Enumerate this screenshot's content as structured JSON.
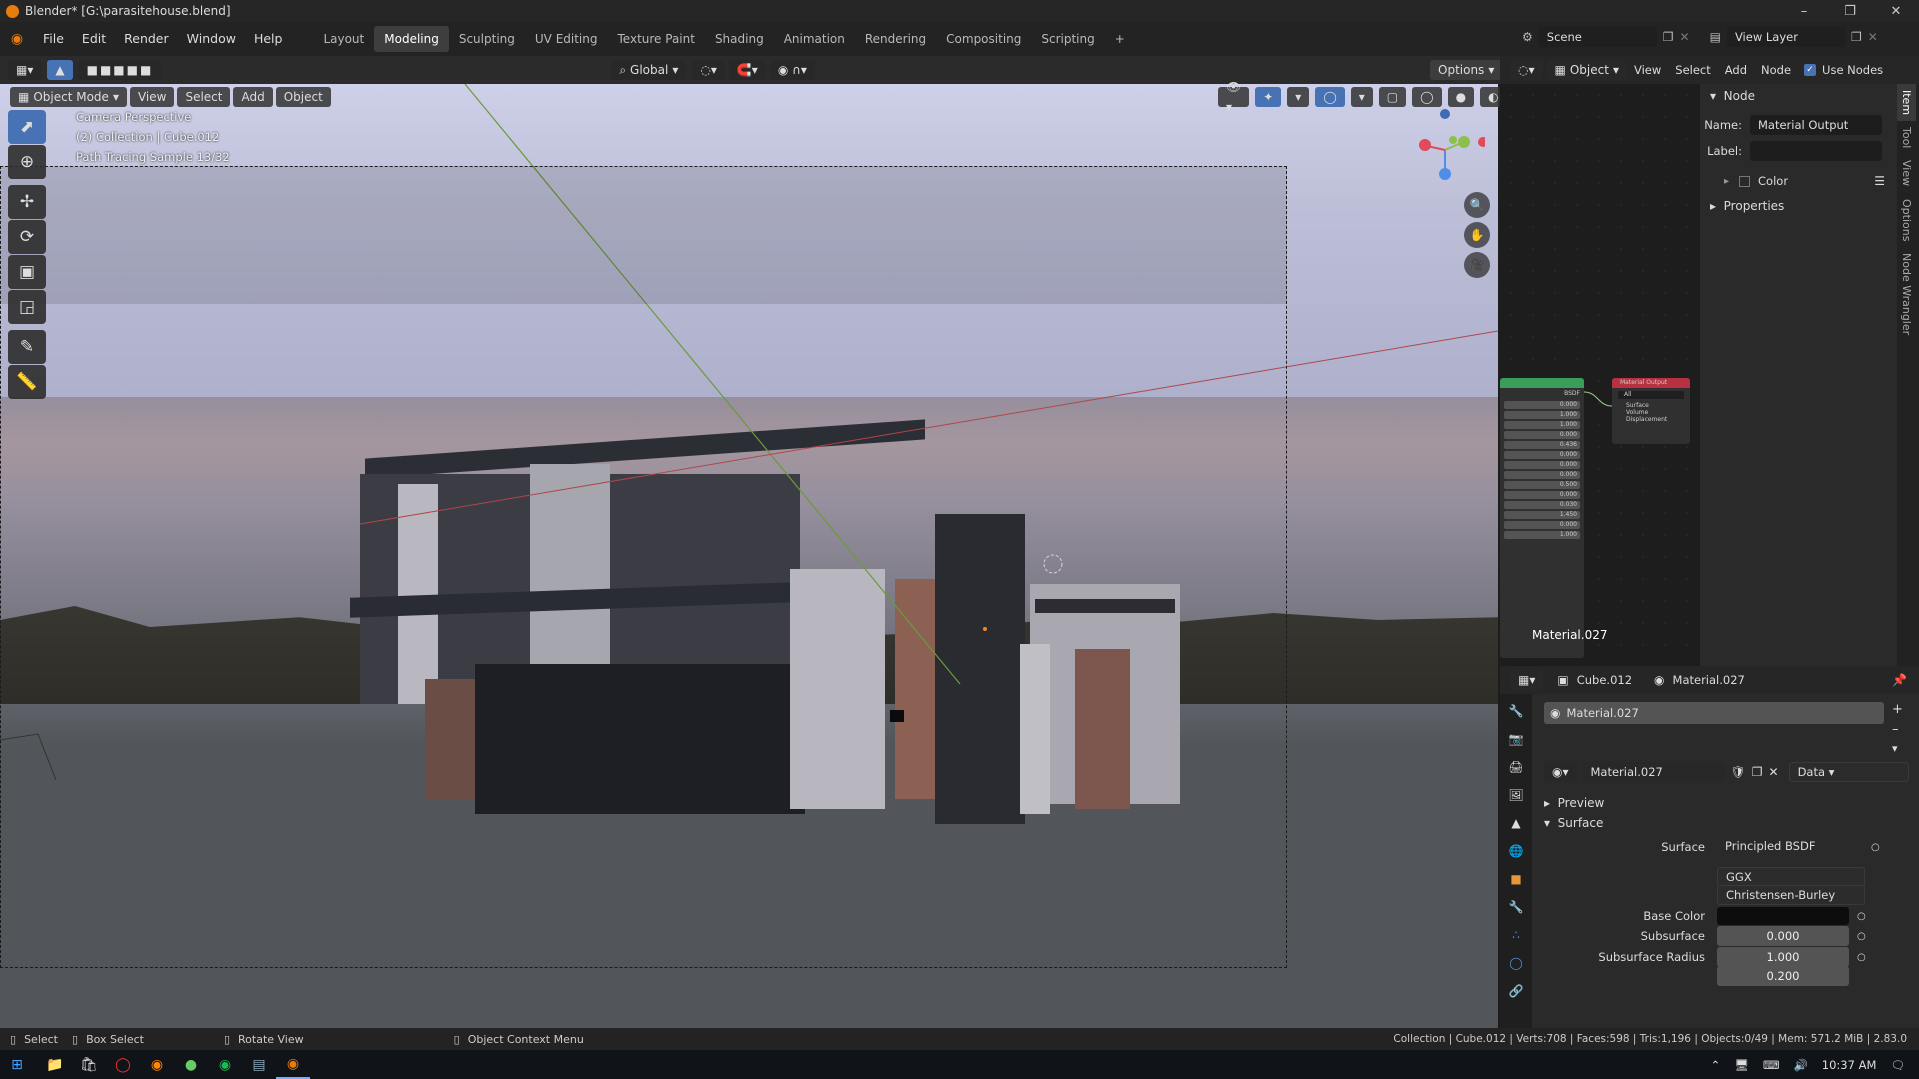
{
  "window": {
    "title": "Blender* [G:\\parasitehouse.blend]"
  },
  "menus": [
    "File",
    "Edit",
    "Render",
    "Window",
    "Help"
  ],
  "workspaces": [
    "Layout",
    "Modeling",
    "Sculpting",
    "UV Editing",
    "Texture Paint",
    "Shading",
    "Animation",
    "Rendering",
    "Compositing",
    "Scripting"
  ],
  "active_workspace": "Modeling",
  "scene": {
    "name": "Scene",
    "view_layer": "View Layer"
  },
  "toolrow": {
    "orientation": "Global",
    "options": "Options"
  },
  "viewport_header": {
    "mode": "Object Mode",
    "menus": [
      "View",
      "Select",
      "Add",
      "Object"
    ]
  },
  "viewport_overlay": {
    "line1": "Camera Perspective",
    "line2": "(2) Collection | Cube.012",
    "line3": "Path Tracing Sample 13/32"
  },
  "node_editor": {
    "header": {
      "type": "Object",
      "menus": [
        "View",
        "Select",
        "Add",
        "Node"
      ],
      "use_nodes": "Use Nodes"
    },
    "bsdf_node": {
      "socket": "BSDF",
      "values": [
        "0.000",
        "1.000",
        "1.000",
        "0.000",
        "0.436",
        "0.000",
        "0.000",
        "0.000",
        "0.500",
        "0.000",
        "0.030",
        "1.450",
        "0.000",
        "1.000"
      ]
    },
    "output_node": {
      "title": "Material Output",
      "target": "All",
      "sockets": [
        "Surface",
        "Volume",
        "Displacement"
      ]
    },
    "material_label": "Material.027"
  },
  "npanel": {
    "section": "Node",
    "name_label": "Name:",
    "name_value": "Material Output",
    "label_label": "Label:",
    "color_label": "Color",
    "properties_label": "Properties",
    "tabs": [
      "Item",
      "Tool",
      "View",
      "Options",
      "Node Wrangler"
    ]
  },
  "properties": {
    "breadcrumb_object": "Cube.012",
    "breadcrumb_material": "Material.027",
    "slot": "Material.027",
    "material_name": "Material.027",
    "link": "Data",
    "preview_label": "Preview",
    "surface_label": "Surface",
    "rows": [
      {
        "label": "Surface",
        "value": "Principled BSDF"
      },
      {
        "label": "",
        "value": "GGX"
      },
      {
        "label": "",
        "value": "Christensen-Burley"
      },
      {
        "label": "Base Color",
        "value": ""
      },
      {
        "label": "Subsurface",
        "value": "0.000"
      },
      {
        "label": "Subsurface Radius",
        "value": "1.000"
      },
      {
        "label": "",
        "value": "0.200"
      }
    ]
  },
  "statusbar": {
    "select": "Select",
    "box_select": "Box Select",
    "rotate": "Rotate View",
    "context": "Object Context Menu",
    "stats": "Collection | Cube.012 | Verts:708 | Faces:598 | Tris:1,196 | Objects:0/49 | Mem: 571.2 MiB | 2.83.0"
  },
  "taskbar": {
    "time": "10:37 AM"
  }
}
